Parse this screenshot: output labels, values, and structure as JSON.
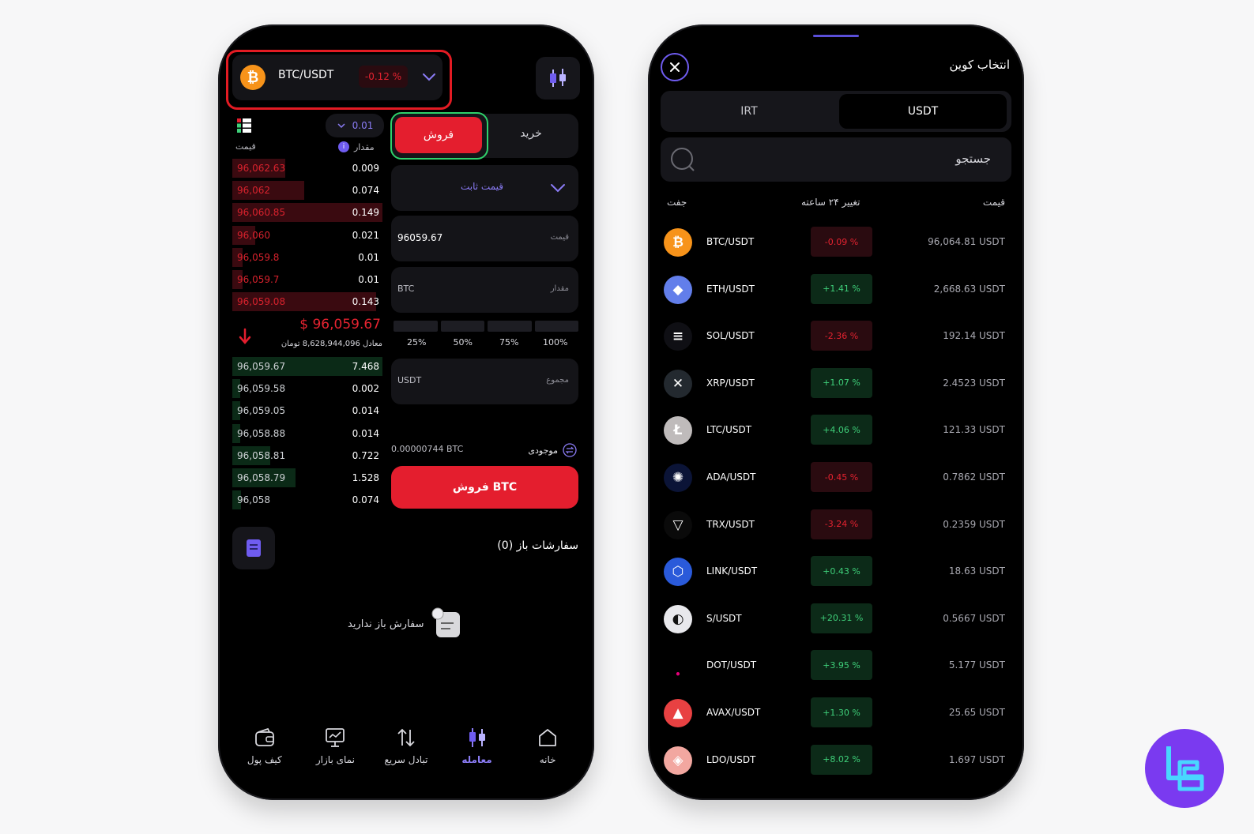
{
  "left": {
    "pair": {
      "label": "BTC/USDT",
      "change": "-0.12 %",
      "icon": "bitcoin-icon"
    },
    "orderbook": {
      "tick_size": "0.01",
      "price_header": "قیمت",
      "amount_header": "مقدار",
      "asks": [
        {
          "price": "96,062.63",
          "amount": "0.009",
          "depth": 0.35
        },
        {
          "price": "96,062",
          "amount": "0.074",
          "depth": 0.48
        },
        {
          "price": "96,060.85",
          "amount": "0.149",
          "depth": 1.0
        },
        {
          "price": "96,060",
          "amount": "0.021",
          "depth": 0.15
        },
        {
          "price": "96,059.8",
          "amount": "0.01",
          "depth": 0.07
        },
        {
          "price": "96,059.7",
          "amount": "0.01",
          "depth": 0.07
        },
        {
          "price": "96,059.08",
          "amount": "0.143",
          "depth": 0.96
        }
      ],
      "last_price": "$ 96,059.67",
      "toman_equiv": "معادل  8,628,944,096 تومان",
      "bids": [
        {
          "price": "96,059.67",
          "amount": "7.468",
          "depth": 1.0
        },
        {
          "price": "96,059.58",
          "amount": "0.002",
          "depth": 0.05
        },
        {
          "price": "96,059.05",
          "amount": "0.014",
          "depth": 0.05
        },
        {
          "price": "96,058.88",
          "amount": "0.014",
          "depth": 0.05
        },
        {
          "price": "96,058.81",
          "amount": "0.722",
          "depth": 0.25
        },
        {
          "price": "96,058.79",
          "amount": "1.528",
          "depth": 0.42
        },
        {
          "price": "96,058",
          "amount": "0.074",
          "depth": 0.06
        }
      ]
    },
    "trade": {
      "sell_tab": "فروش",
      "buy_tab": "خرید",
      "order_type": "قیمت ثابت",
      "price_label": "قیمت",
      "price_value": "96059.67",
      "amount_label": "مقدار",
      "amount_unit": "BTC",
      "percents": [
        "25%",
        "50%",
        "75%",
        "100%"
      ],
      "total_label": "مجموع",
      "total_unit": "USDT",
      "balance_label": "موجودی",
      "balance_value": "0.00000744 BTC",
      "sell_button": "فروش BTC"
    },
    "open_orders": {
      "title": "سفارشات باز (0)",
      "empty_text": "سفارش باز ندارید"
    },
    "nav": [
      {
        "label": "کیف پول",
        "icon": "wallet-icon",
        "active": false
      },
      {
        "label": "نمای بازار",
        "icon": "market-view-icon",
        "active": false
      },
      {
        "label": "تبادل سریع",
        "icon": "swap-arrows-icon",
        "active": false
      },
      {
        "label": "معامله",
        "icon": "candlestick-icon",
        "active": true
      },
      {
        "label": "خانه",
        "icon": "home-icon",
        "active": false
      }
    ]
  },
  "right": {
    "title": "انتخاب کوین",
    "tabs": [
      "IRT",
      "USDT"
    ],
    "selected_tab": "USDT",
    "search_placeholder": "جستجو",
    "columns": {
      "pair": "جفت",
      "change": "تغییر ۲۴ ساعته",
      "price": "قیمت"
    },
    "coins": [
      {
        "pair": "BTC/USDT",
        "change": "-0.09 %",
        "direction": "down",
        "price": "96,064.81 USDT",
        "icon": "bitcoin-icon"
      },
      {
        "pair": "ETH/USDT",
        "change": "+1.41 %",
        "direction": "up",
        "price": "2,668.63 USDT",
        "icon": "ethereum-icon"
      },
      {
        "pair": "SOL/USDT",
        "change": "-2.36 %",
        "direction": "down",
        "price": "192.14 USDT",
        "icon": "solana-icon"
      },
      {
        "pair": "XRP/USDT",
        "change": "+1.07 %",
        "direction": "up",
        "price": "2.4523 USDT",
        "icon": "xrp-icon"
      },
      {
        "pair": "LTC/USDT",
        "change": "+4.06 %",
        "direction": "up",
        "price": "121.33 USDT",
        "icon": "litecoin-icon"
      },
      {
        "pair": "ADA/USDT",
        "change": "-0.45 %",
        "direction": "down",
        "price": "0.7862 USDT",
        "icon": "cardano-icon"
      },
      {
        "pair": "TRX/USDT",
        "change": "-3.24 %",
        "direction": "down",
        "price": "0.2359 USDT",
        "icon": "tron-icon"
      },
      {
        "pair": "LINK/USDT",
        "change": "+0.43 %",
        "direction": "up",
        "price": "18.63 USDT",
        "icon": "chainlink-icon"
      },
      {
        "pair": "S/USDT",
        "change": "+20.31 %",
        "direction": "up",
        "price": "0.5667 USDT",
        "icon": "sonic-icon"
      },
      {
        "pair": "DOT/USDT",
        "change": "+3.95 %",
        "direction": "up",
        "price": "5.177 USDT",
        "icon": "polkadot-icon"
      },
      {
        "pair": "AVAX/USDT",
        "change": "+1.30 %",
        "direction": "up",
        "price": "25.65 USDT",
        "icon": "avalanche-icon"
      },
      {
        "pair": "LDO/USDT",
        "change": "+8.02 %",
        "direction": "up",
        "price": "1.697 USDT",
        "icon": "lido-icon"
      }
    ]
  },
  "colors": {
    "accent": "#8b7cf6",
    "sell_red": "#e41e2e",
    "buy_green": "#3fd07a",
    "btc_orange": "#f7931a"
  }
}
